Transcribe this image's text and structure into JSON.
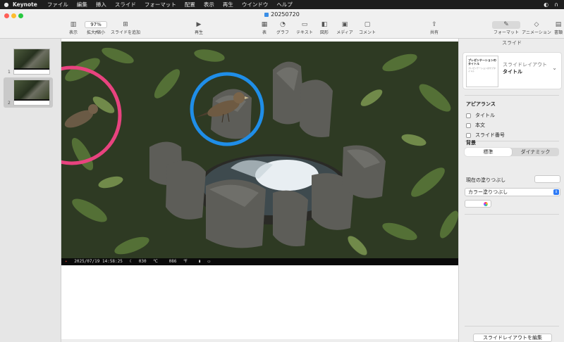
{
  "menubar": {
    "apple": "",
    "app": "Keynote",
    "items": [
      "ファイル",
      "編集",
      "挿入",
      "スライド",
      "フォーマット",
      "配置",
      "表示",
      "再生",
      "ウインドウ",
      "ヘルプ"
    ],
    "status_icons": [
      "display-icon",
      "headphones-icon"
    ]
  },
  "window": {
    "title": "20250720",
    "traffic_lights": {
      "close": "#ff5f57",
      "minimize": "#febc2e",
      "zoom": "#28c840"
    }
  },
  "toolbar": {
    "view": "表示",
    "zoom_value": "97%",
    "zoom_label": "拡大/縮小",
    "add_slide": "スライドを追加",
    "play": "再生",
    "table": "表",
    "chart": "グラフ",
    "text": "テキスト",
    "shape": "図形",
    "media": "メディア",
    "comment": "コメント",
    "share": "共有",
    "format": "フォーマット",
    "animate": "アニメーション",
    "document": "書類"
  },
  "navigator": {
    "slides": [
      {
        "number": "1"
      },
      {
        "number": "2"
      }
    ],
    "selected_index": 2
  },
  "slide": {
    "caption": {
      "datetime": "2025/07/19  14:58:25",
      "temp_c": "030",
      "temp_c_unit": "℃",
      "temp_f": "086",
      "temp_f_unit": "℉"
    },
    "annotations": [
      {
        "color": "#e8437f",
        "shape": "circle"
      },
      {
        "color": "#1f8ee8",
        "shape": "circle"
      }
    ]
  },
  "inspector": {
    "title": "スライド",
    "layout": {
      "label": "スライドレイアウト",
      "value": "タイトル",
      "thumb_title": "プレゼンテーションのタイトル",
      "thumb_sub": "プレゼンテーションのサブタイトル"
    },
    "appearance": {
      "heading": "アピアランス",
      "options": [
        {
          "label": "タイトル",
          "checked": false
        },
        {
          "label": "本文",
          "checked": false
        },
        {
          "label": "スライド番号",
          "checked": false
        }
      ]
    },
    "background": {
      "heading": "背景",
      "segments": [
        "標準",
        "ダイナミック"
      ],
      "selected": "標準",
      "current_fill_label": "現在の塗りつぶし",
      "fill_type": "カラー塗りつぶし"
    },
    "edit_layout_button": "スライドレイアウトを編集"
  }
}
